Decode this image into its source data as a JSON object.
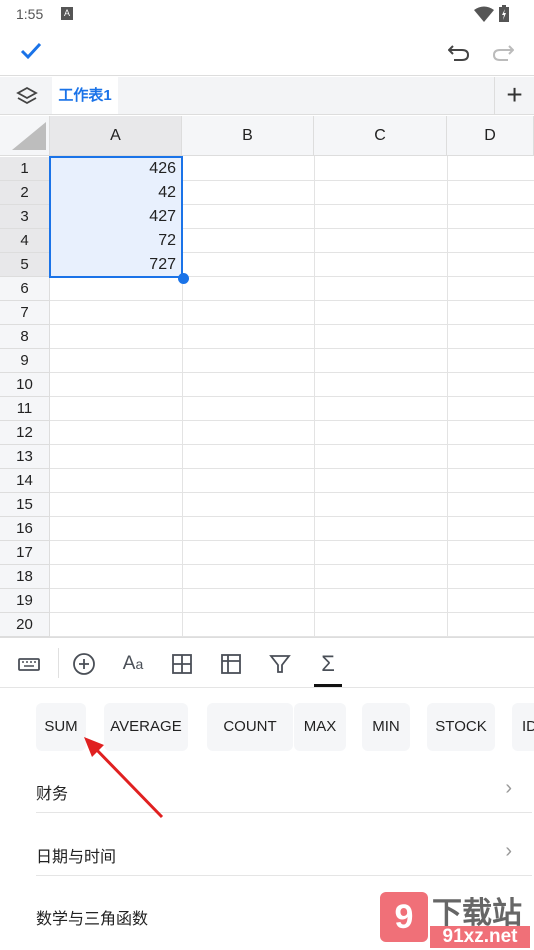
{
  "status": {
    "time": "1:55",
    "notif_icon": "A"
  },
  "sheet_tab": "工作表1",
  "columns": [
    "A",
    "B",
    "C",
    "D"
  ],
  "rows": [
    "1",
    "2",
    "3",
    "4",
    "5",
    "6",
    "7",
    "8",
    "9",
    "10",
    "11",
    "12",
    "13",
    "14",
    "15",
    "16",
    "17",
    "18",
    "19",
    "20"
  ],
  "values": [
    "426",
    "42",
    "427",
    "72",
    "727"
  ],
  "functions": [
    "SUM",
    "AVERAGE",
    "COUNT",
    "MAX",
    "MIN",
    "STOCK",
    "ID"
  ],
  "categories": [
    "财务",
    "日期与时间",
    "数学与三角函数"
  ],
  "watermark": {
    "text": "下载站",
    "url_text": "91xz.net"
  },
  "colors": {
    "accent": "#1a73e8",
    "selection_fill": "#e8f0fd",
    "arrow": "#e02020"
  }
}
